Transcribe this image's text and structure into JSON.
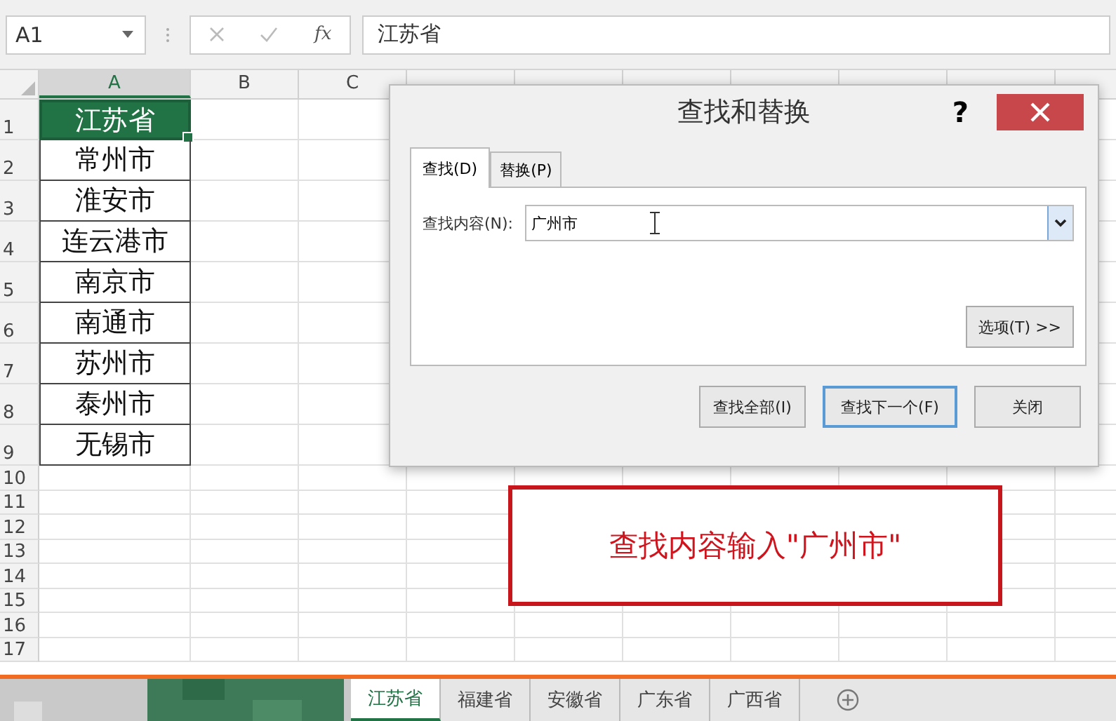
{
  "name_box": "A1",
  "formula_bar": {
    "function_label": "fx",
    "formula": "江苏省"
  },
  "columns": [
    "A",
    "B",
    "C"
  ],
  "rows": [
    {
      "number": "1",
      "cell_a": "江苏省",
      "selected": true
    },
    {
      "number": "2",
      "cell_a": "常州市",
      "selected": false
    },
    {
      "number": "3",
      "cell_a": "淮安市",
      "selected": false
    },
    {
      "number": "4",
      "cell_a": "连云港市",
      "selected": false
    },
    {
      "number": "5",
      "cell_a": "南京市",
      "selected": false
    },
    {
      "number": "6",
      "cell_a": "南通市",
      "selected": false
    },
    {
      "number": "7",
      "cell_a": "苏州市",
      "selected": false
    },
    {
      "number": "8",
      "cell_a": "泰州市",
      "selected": false
    },
    {
      "number": "9",
      "cell_a": "无锡市",
      "selected": false
    },
    {
      "number": "10"
    },
    {
      "number": "11"
    },
    {
      "number": "12"
    },
    {
      "number": "13"
    },
    {
      "number": "14"
    },
    {
      "number": "15"
    },
    {
      "number": "16"
    },
    {
      "number": "17"
    }
  ],
  "dialog": {
    "title": "查找和替换",
    "help": "?",
    "tabs": [
      {
        "label": "查找(D)",
        "selected": true
      },
      {
        "label": "替换(P)",
        "selected": false
      }
    ],
    "find_label": "查找内容(N):",
    "find_value": "广州市",
    "options_button": "选项(T) >>",
    "buttons": [
      {
        "label": "查找全部(I)",
        "focused": false
      },
      {
        "label": "查找下一个(F)",
        "focused": true
      },
      {
        "label": "关闭",
        "focused": false
      }
    ]
  },
  "annotation": "查找内容输入\"广州市\"",
  "sheet_tabs": [
    {
      "label": "江苏省",
      "selected": true
    },
    {
      "label": "福建省",
      "selected": false
    },
    {
      "label": "安徽省",
      "selected": false
    },
    {
      "label": "广东省",
      "selected": false
    },
    {
      "label": "广西省",
      "selected": false
    }
  ]
}
